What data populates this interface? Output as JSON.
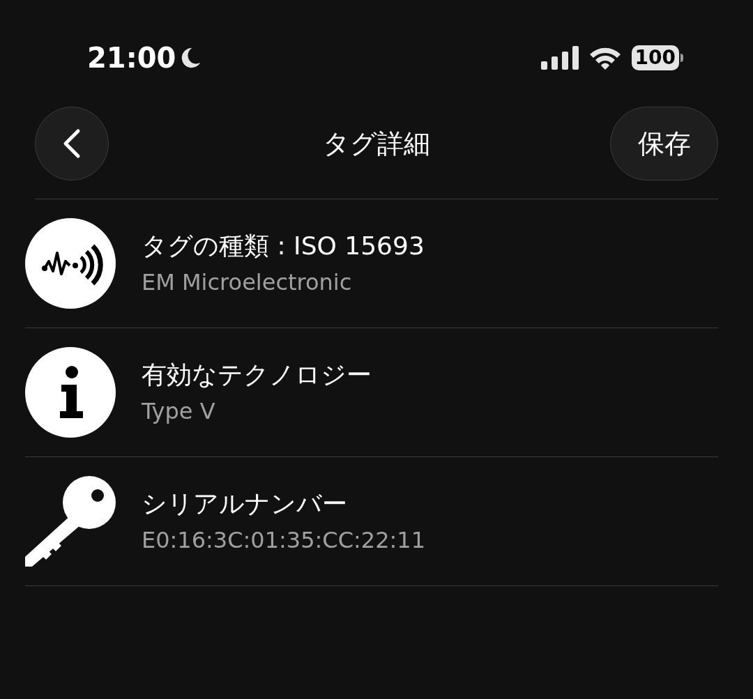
{
  "status_bar": {
    "time": "21:00",
    "battery": "100"
  },
  "header": {
    "title": "タグ詳細",
    "save_button": "保存"
  },
  "rows": [
    {
      "kind": "tag-type",
      "title": "タグの種類 : ISO 15693",
      "subtitle": "EM Microelectronic"
    },
    {
      "kind": "info",
      "title": "有効なテクノロジー",
      "subtitle": "Type V"
    },
    {
      "kind": "key",
      "title": "シリアルナンバー",
      "subtitle": "E0:16:3C:01:35:CC:22:11"
    }
  ]
}
